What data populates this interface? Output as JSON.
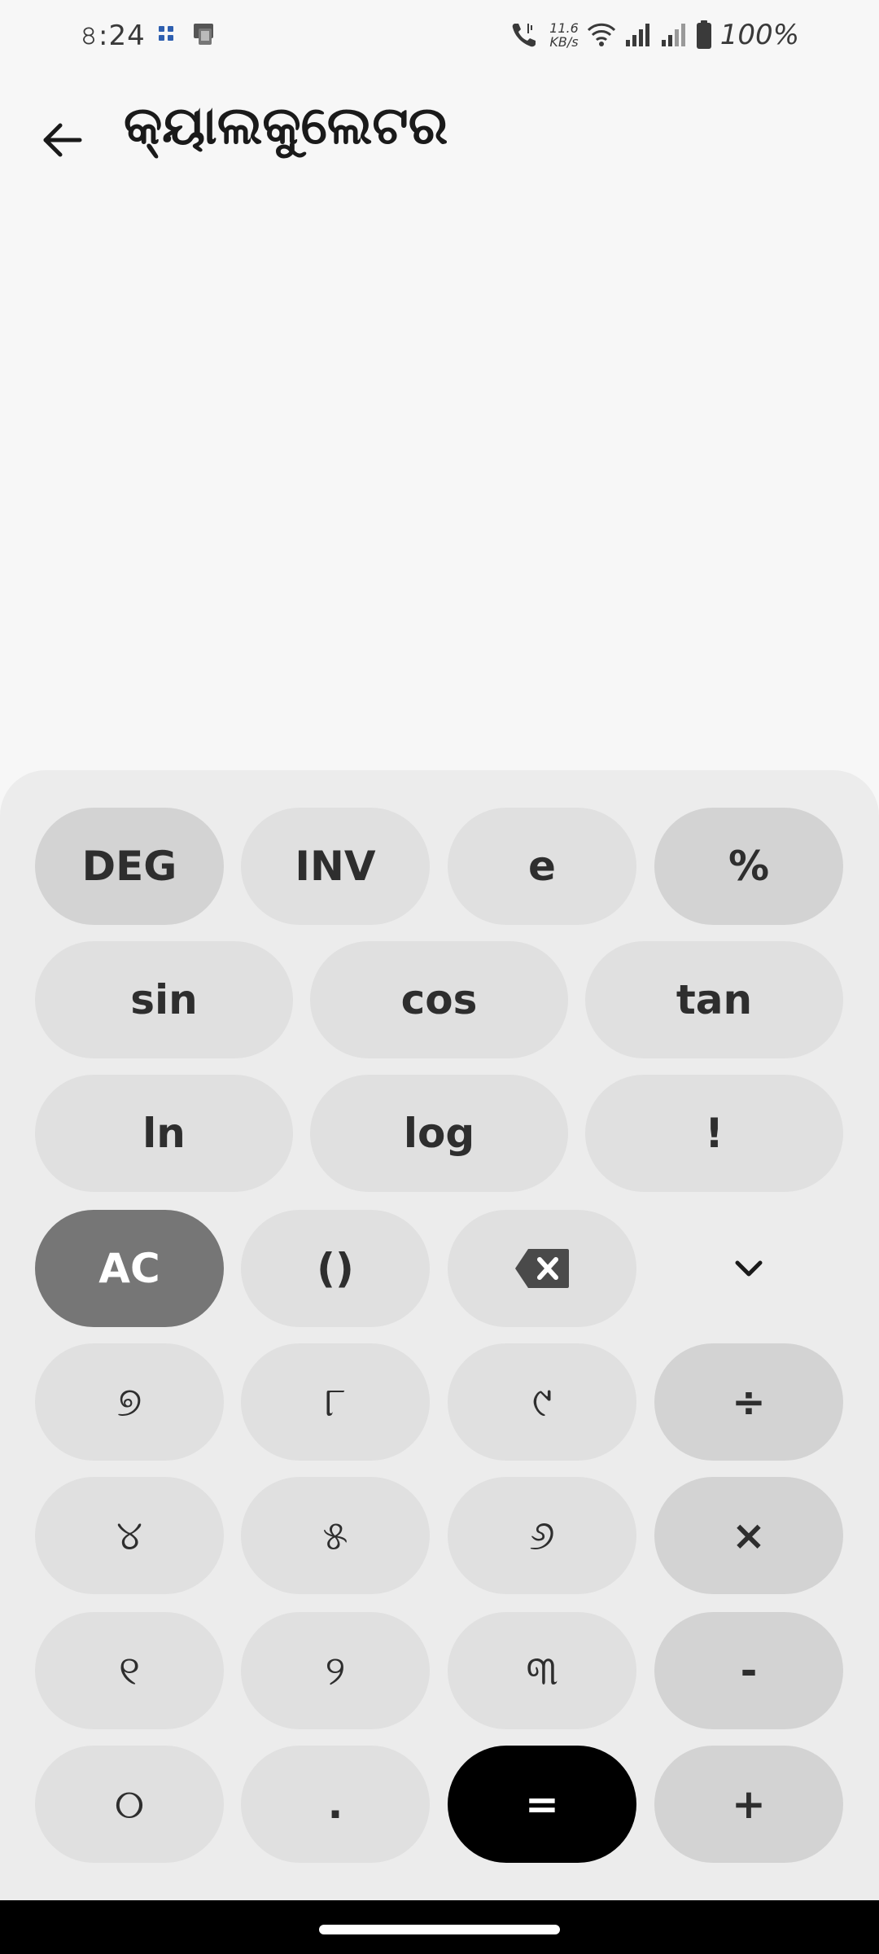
{
  "status_bar": {
    "time": "৪:24",
    "net_speed_value": "11.6",
    "net_speed_unit": "KB/s",
    "battery": "100%"
  },
  "header": {
    "title": "କ୍ୟାଲକୁଲେଟର"
  },
  "keypad": {
    "row1": [
      "DEG",
      "INV",
      "e",
      "%"
    ],
    "row2": [
      "sin",
      "cos",
      "tan"
    ],
    "row3": [
      "ln",
      "log",
      "!"
    ],
    "row4": [
      "AC",
      "()"
    ],
    "row5": [
      "୭",
      "୮",
      "୯",
      "÷"
    ],
    "row6": [
      "୪",
      "୫",
      "୬",
      "×"
    ],
    "row7": [
      "୧",
      "୨",
      "୩",
      "-"
    ],
    "row8": [
      "୦",
      ".",
      "=",
      "+"
    ]
  }
}
